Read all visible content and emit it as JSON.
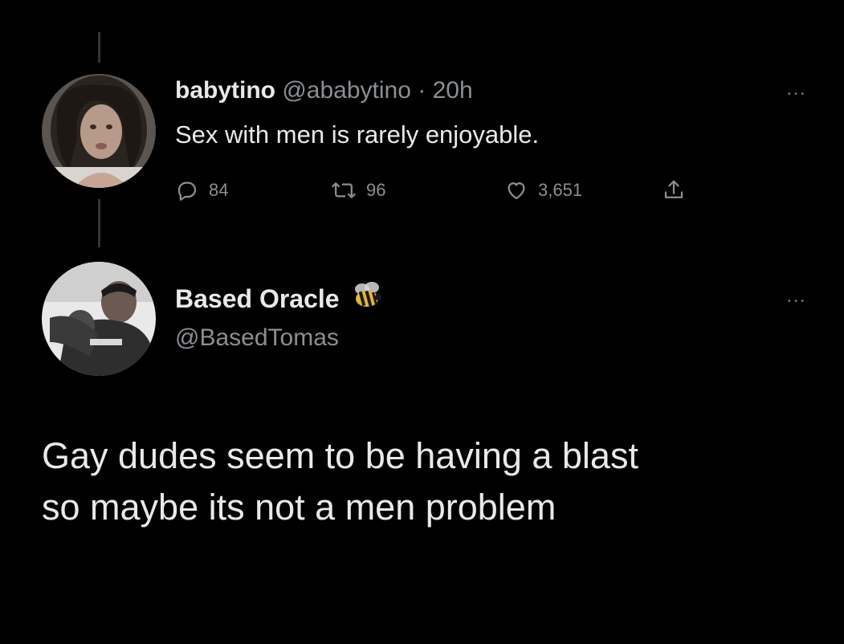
{
  "tweet": {
    "display_name": "babytino",
    "handle": "@ababytino",
    "separator": "·",
    "time": "20h",
    "text": "Sex with men is rarely enjoyable.",
    "metrics": {
      "replies": "84",
      "retweets": "96",
      "likes": "3,651"
    },
    "more_icon": "…"
  },
  "reply": {
    "display_name": "Based Oracle",
    "badge_icon": "bee-icon",
    "handle": "@BasedTomas",
    "text_lines": [
      "Gay dudes seem to be having a blast",
      "so maybe its not a men problem"
    ],
    "more_icon": "…"
  },
  "colors": {
    "background": "#000000",
    "primary_text": "#e7e9ea",
    "secondary_text": "#8b8f93",
    "thread_line": "#333639"
  }
}
